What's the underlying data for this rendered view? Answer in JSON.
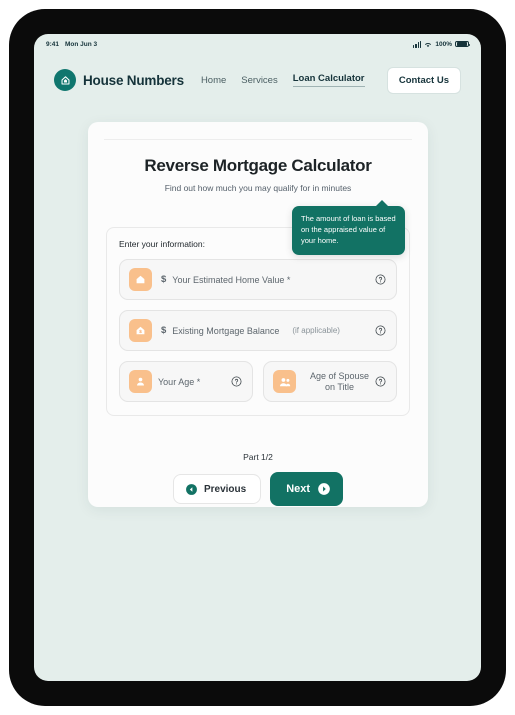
{
  "status_bar": {
    "time": "9:41",
    "date": "Mon Jun 3",
    "battery": "100%",
    "signal_icon": "cellular-signal-icon",
    "wifi_icon": "wifi-icon",
    "battery_icon": "battery-icon"
  },
  "header": {
    "brand_name": "House Numbers",
    "logo_icon": "house-arrow-logo-icon",
    "nav": [
      {
        "label": "Home",
        "active": false
      },
      {
        "label": "Services",
        "active": false
      },
      {
        "label": "Loan Calculator",
        "active": true
      }
    ],
    "contact_button": "Contact Us"
  },
  "card": {
    "title": "Reverse Mortgage Calculator",
    "subtitle": "Find out how much you may qualify for in minutes",
    "panel_label": "Enter your information:",
    "fields": [
      {
        "label": "Your Estimated Home Value *",
        "note": "",
        "prefix": "$",
        "icon": "house-icon",
        "help_icon": "question-circle-icon"
      },
      {
        "label": "Existing Mortgage Balance",
        "note": "(if applicable)",
        "prefix": "$",
        "icon": "house-dollar-icon",
        "help_icon": "question-circle-icon"
      },
      {
        "label": "Your Age *",
        "note": "",
        "prefix": "",
        "icon": "person-icon",
        "help_icon": "question-circle-icon"
      },
      {
        "label": "Age of Spouse on Title",
        "note": "",
        "prefix": "",
        "icon": "people-icon",
        "help_icon": "question-circle-icon"
      }
    ],
    "tooltip": "The amount of loan is based on the appraised value of your home.",
    "part_indicator": "Part 1/2",
    "previous_button": "Previous",
    "next_button": "Next",
    "previous_icon": "chevron-left-circle-icon",
    "next_icon": "chevron-right-circle-icon"
  },
  "colors": {
    "brand_teal": "#0f766e",
    "tooltip_teal": "#127264",
    "accent_orange": "#f9c08c",
    "screen_bg": "#e4eeeb"
  }
}
